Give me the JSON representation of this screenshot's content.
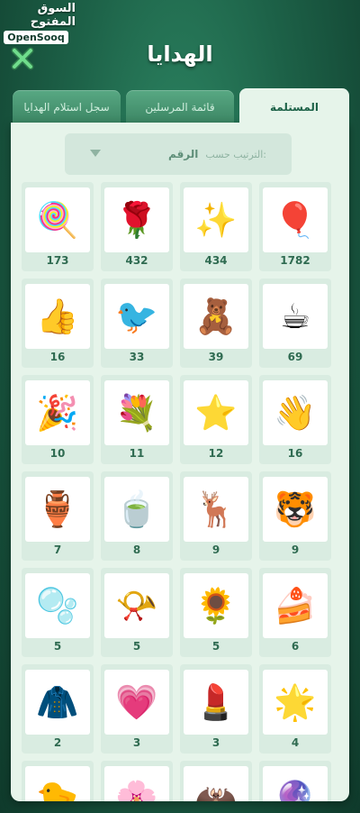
{
  "watermark": {
    "arabic": "السوق المفتوح",
    "english": "OpenSooq"
  },
  "header": {
    "title": "الهدايا"
  },
  "tabs": [
    {
      "label": "المستلمة",
      "active": true
    },
    {
      "label": "قائمة المرسلين",
      "active": false
    },
    {
      "label": "سجل استلام الهدايا",
      "active": false
    }
  ],
  "sort": {
    "label": "الترتيب حسب:",
    "value": "الرقم"
  },
  "colors": {
    "accent": "#1d6248",
    "panel": "#e6f4ea",
    "count_text": "#2f6b51",
    "close_icon": "#6fdc8c"
  },
  "gifts": [
    {
      "icon": "balloons",
      "glyph": "🎈",
      "count": "1782"
    },
    {
      "icon": "calligraphy-gold",
      "glyph": "✨",
      "count": "434"
    },
    {
      "icon": "red-rose",
      "glyph": "🌹",
      "count": "432"
    },
    {
      "icon": "lollipop",
      "glyph": "🍭",
      "count": "173"
    },
    {
      "icon": "coffee-cup",
      "glyph": "☕",
      "count": "69"
    },
    {
      "icon": "teddy-bear",
      "glyph": "🧸",
      "count": "39"
    },
    {
      "icon": "black-bird",
      "glyph": "🐦",
      "count": "33"
    },
    {
      "icon": "nice-sign",
      "glyph": "👍",
      "count": "16"
    },
    {
      "icon": "hi-sign",
      "glyph": "👋",
      "count": "16"
    },
    {
      "icon": "star-boat",
      "glyph": "⭐",
      "count": "12"
    },
    {
      "icon": "blue-rose-bouquet",
      "glyph": "💐",
      "count": "11"
    },
    {
      "icon": "happy-new-year",
      "glyph": "🎉",
      "count": "10"
    },
    {
      "icon": "tiger-cub",
      "glyph": "🐯",
      "count": "9"
    },
    {
      "icon": "reindeer",
      "glyph": "🦌",
      "count": "9"
    },
    {
      "icon": "tea-cup",
      "glyph": "🍵",
      "count": "8"
    },
    {
      "icon": "hookah",
      "glyph": "🏺",
      "count": "7"
    },
    {
      "icon": "cake",
      "glyph": "🍰",
      "count": "6"
    },
    {
      "icon": "sunflowers",
      "glyph": "🌻",
      "count": "5"
    },
    {
      "icon": "party-horn",
      "glyph": "📯",
      "count": "5"
    },
    {
      "icon": "bubbles",
      "glyph": "🫧",
      "count": "5"
    },
    {
      "icon": "golden-calligraphy",
      "glyph": "🌟",
      "count": "4"
    },
    {
      "icon": "lipstick",
      "glyph": "💄",
      "count": "3"
    },
    {
      "icon": "heart-lollipop",
      "glyph": "💗",
      "count": "3"
    },
    {
      "icon": "blue-cape",
      "glyph": "🧥",
      "count": "2"
    },
    {
      "icon": "purple-lamp",
      "glyph": "🔮",
      "count": ""
    },
    {
      "icon": "bat-wings",
      "glyph": "🦇",
      "count": ""
    },
    {
      "icon": "pink-flowers",
      "glyph": "🌸",
      "count": ""
    },
    {
      "icon": "rubber-duck",
      "glyph": "🐤",
      "count": ""
    }
  ]
}
